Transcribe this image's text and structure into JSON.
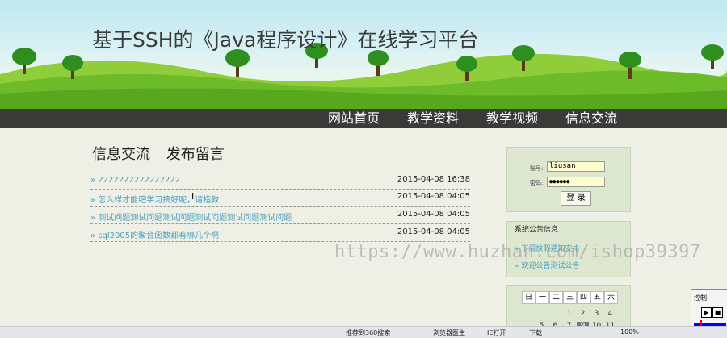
{
  "site": {
    "title": "基于SSH的《Java程序设计》在线学习平台"
  },
  "nav": {
    "items": [
      "网站首页",
      "教学资料",
      "教学视频",
      "信息交流"
    ]
  },
  "section": {
    "title": "信息交流",
    "action": "发布留言"
  },
  "messages": [
    {
      "title": "2222222222222222",
      "date": "2015-04-08 16:38"
    },
    {
      "title": "怎么样才能吧学习搞好呢，请指教",
      "date": "2015-04-08 04:05"
    },
    {
      "title": "测试问题测试问题测试问题测试问题测试问题测试问题",
      "date": "2015-04-08 04:05"
    },
    {
      "title": "sql2005的聚合函数都有哪几个啊",
      "date": "2015-04-08 04:05"
    }
  ],
  "login": {
    "username_label": "账号:",
    "username_value": "liusan",
    "password_label": "密码:",
    "password_value": "●●●●●●",
    "button": "登 录"
  },
  "notice": {
    "title": "系统公告信息",
    "items": [
      "下周放假通知安排",
      "欢迎公告测试公告"
    ]
  },
  "calendar": {
    "weekdays": [
      "日",
      "一",
      "二",
      "三",
      "四",
      "五",
      "六"
    ],
    "days": [
      "1",
      "2",
      "3",
      "4",
      "5",
      "6",
      "7",
      "8",
      "9",
      "10",
      "11"
    ],
    "today": "9"
  },
  "watermark": "https://www.huzhan.com/ishop39397",
  "statusbar": {
    "items": [
      "推荐到360搜索",
      "浏览器医生",
      "IE打开",
      "下载",
      "100%"
    ]
  },
  "control_panel": {
    "title": "控制"
  }
}
